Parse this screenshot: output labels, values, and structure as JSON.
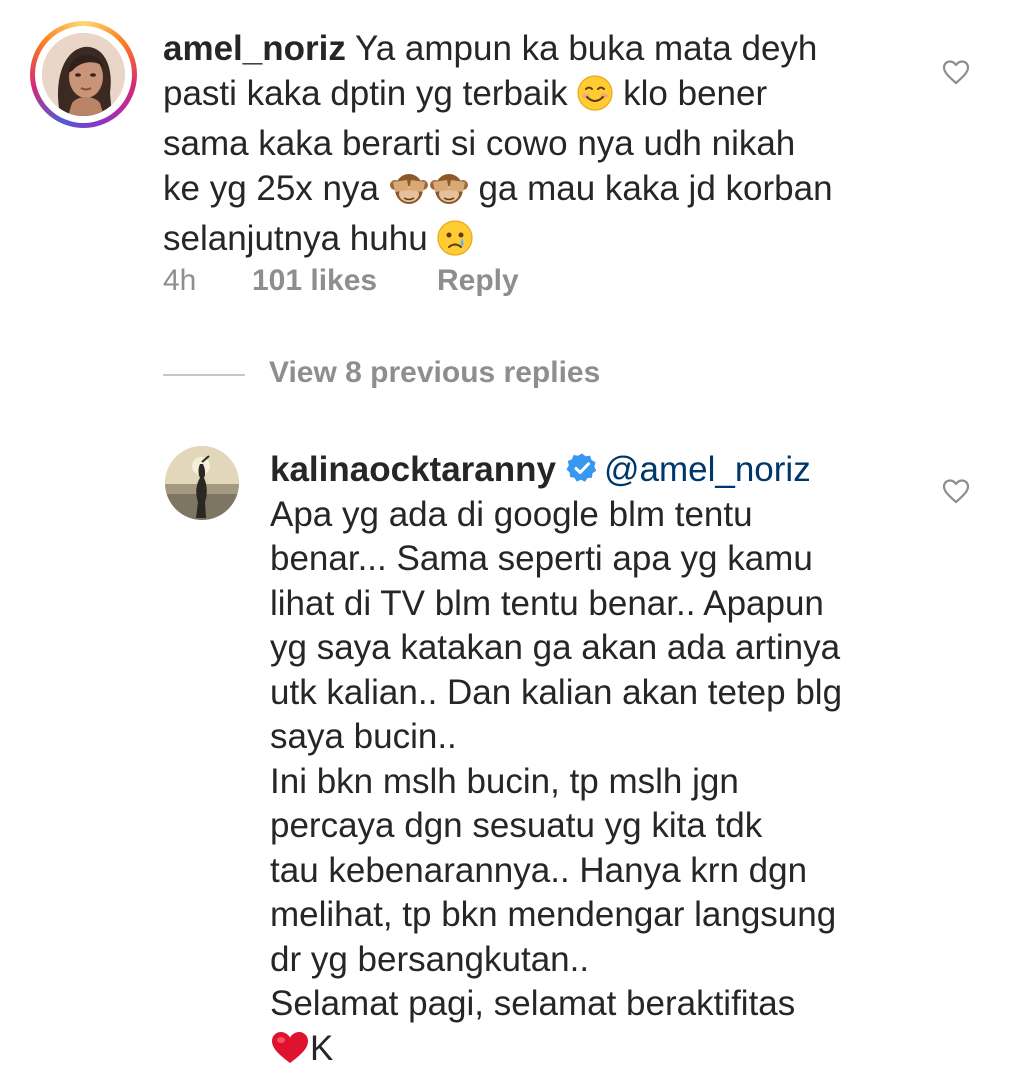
{
  "top_comment": {
    "username": "amel_noriz",
    "lines": [
      "Ya ampun ka buka mata deyh",
      "pasti kaka dptin yg terbaik",
      "klo bener",
      "sama kaka berarti si cowo nya udh nikah",
      "ke yg 25x nya",
      "ga mau kaka jd korban",
      "selanjutnya huhu"
    ],
    "time": "4h",
    "likes": "101 likes",
    "reply_label": "Reply"
  },
  "view_replies": {
    "label": "View 8 previous replies"
  },
  "reply_comment": {
    "username": "kalinaocktaranny",
    "mention": "@amel_noriz",
    "lines": [
      "Apa yg ada di google blm tentu",
      "benar... Sama seperti apa yg kamu",
      "lihat di TV blm tentu benar.. Apapun",
      "yg saya katakan ga akan ada artinya",
      "utk kalian.. Dan kalian akan tetep blg",
      "saya bucin..",
      "Ini bkn mslh bucin, tp mslh jgn",
      "percaya dgn sesuatu yg kita tdk",
      "tau kebenarannya.. Hanya krn dgn",
      "melihat, tp bkn mendengar langsung",
      "dr yg bersangkutan..",
      "Selamat pagi, selamat beraktifitas",
      "K"
    ]
  },
  "icons": {
    "heart": "heart-outline-icon",
    "verified": "verified-badge-icon",
    "emoji_smile": "smiling-face-icon",
    "emoji_monkey": "see-no-evil-monkey-icon",
    "emoji_cry": "crying-face-icon",
    "emoji_heart": "red-heart-icon"
  },
  "colors": {
    "text": "#262626",
    "muted": "#8e8e8e",
    "mention": "#00376b",
    "verified": "#3897f0"
  }
}
